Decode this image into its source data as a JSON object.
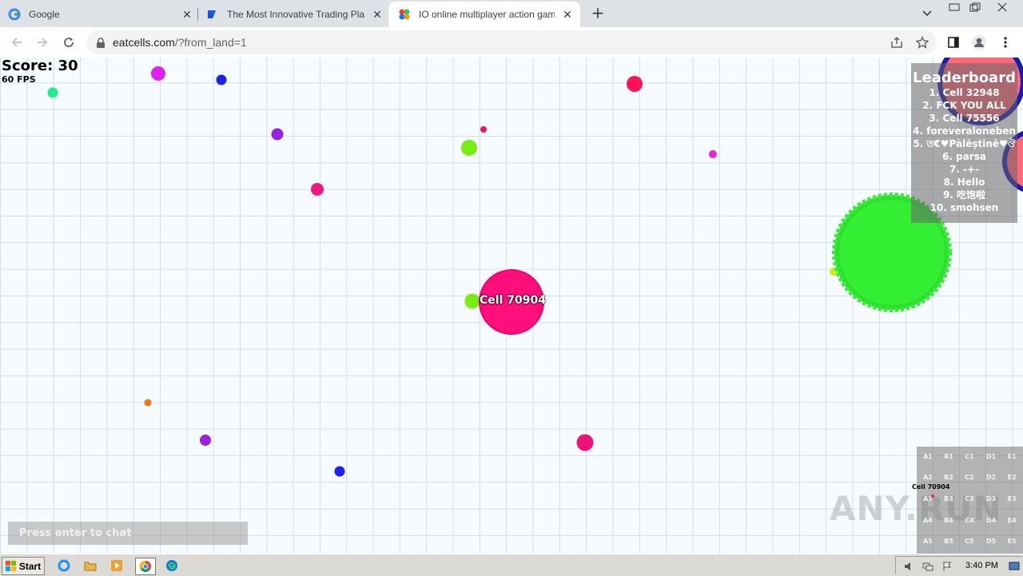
{
  "browser": {
    "tabs": [
      {
        "title": "Google",
        "icon": "google-icon"
      },
      {
        "title": "The Most Innovative Trading Platform",
        "icon": "trading-icon"
      },
      {
        "title": "IO online multiplayer action game. St",
        "icon": "game-icon",
        "active": true
      }
    ],
    "url_host": "eatcells.com",
    "url_path": "/?from_land=1"
  },
  "game": {
    "score_label": "Score: 30",
    "fps_label": "60 FPS",
    "player_name": "Cell 70904",
    "leaderboard": {
      "title": "Leaderboard",
      "entries": [
        "1. Cell 32948",
        "2. FCK YOU ALL",
        "3. Cell 75556",
        "4. foreveraloneben",
        "5. ত€♥Pàlēștinē♥ঔ",
        "6. parsa",
        "7. -+-",
        "8. Hello",
        "9. 吃饱啦",
        "10. smohsen"
      ]
    },
    "chat_placeholder": "Press enter to chat",
    "minimap": {
      "rows": [
        [
          "A1",
          "B1",
          "C1",
          "D1",
          "E1"
        ],
        [
          "A2",
          "B2",
          "C2",
          "D2",
          "E2"
        ],
        [
          "A3",
          "B3",
          "C3",
          "D3",
          "E3"
        ],
        [
          "A4",
          "B4",
          "C4",
          "D4",
          "E4"
        ],
        [
          "A5",
          "B5",
          "C5",
          "D5",
          "E5"
        ]
      ],
      "player_label": "Cell 70904"
    },
    "watermark": "ANY.RUN",
    "colors": {
      "player": "#ff0f7b",
      "big_enemy": "#33ee33"
    }
  },
  "taskbar": {
    "start_label": "Start",
    "clock": "3:40 PM"
  }
}
